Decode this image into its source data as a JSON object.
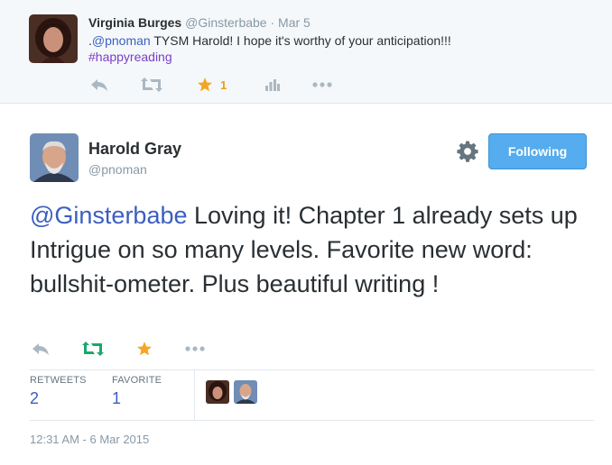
{
  "parent_tweet": {
    "name": "Virginia Burges",
    "handle": "@Ginsterbabe",
    "dot": "·",
    "date": "Mar 5",
    "text_prefix": ".",
    "mention": "@pnoman",
    "text_body": " TYSM Harold! I hope it's worthy of your anticipation!!!",
    "hashtag": "#happyreading",
    "favorite_count": "1",
    "icons": [
      "reply-icon",
      "retweet-icon",
      "favorite-star-icon",
      "analytics-icon",
      "more-icon"
    ]
  },
  "main_tweet": {
    "name": "Harold Gray",
    "handle": "@pnoman",
    "follow_label": "Following",
    "mention": "@Ginsterbabe",
    "text_body": " Loving it! Chapter 1 already sets up Intrigue on so many levels. Favorite new word: bullshit-ometer. Plus beautiful writing !",
    "stats": {
      "retweets_label": "RETWEETS",
      "retweets_value": "2",
      "favorites_label": "FAVORITE",
      "favorites_value": "1"
    },
    "timestamp": "12:31 AM - 6 Mar 2015",
    "icons": [
      "reply-icon",
      "retweet-icon",
      "favorite-star-icon",
      "more-icon"
    ]
  },
  "colors": {
    "follow_button": "#55acee",
    "link": "#3b5fc0",
    "hashtag": "#7b3fc9",
    "retweeted": "#19a96b",
    "favorited": "#f5a623",
    "muted": "#8899a6"
  }
}
